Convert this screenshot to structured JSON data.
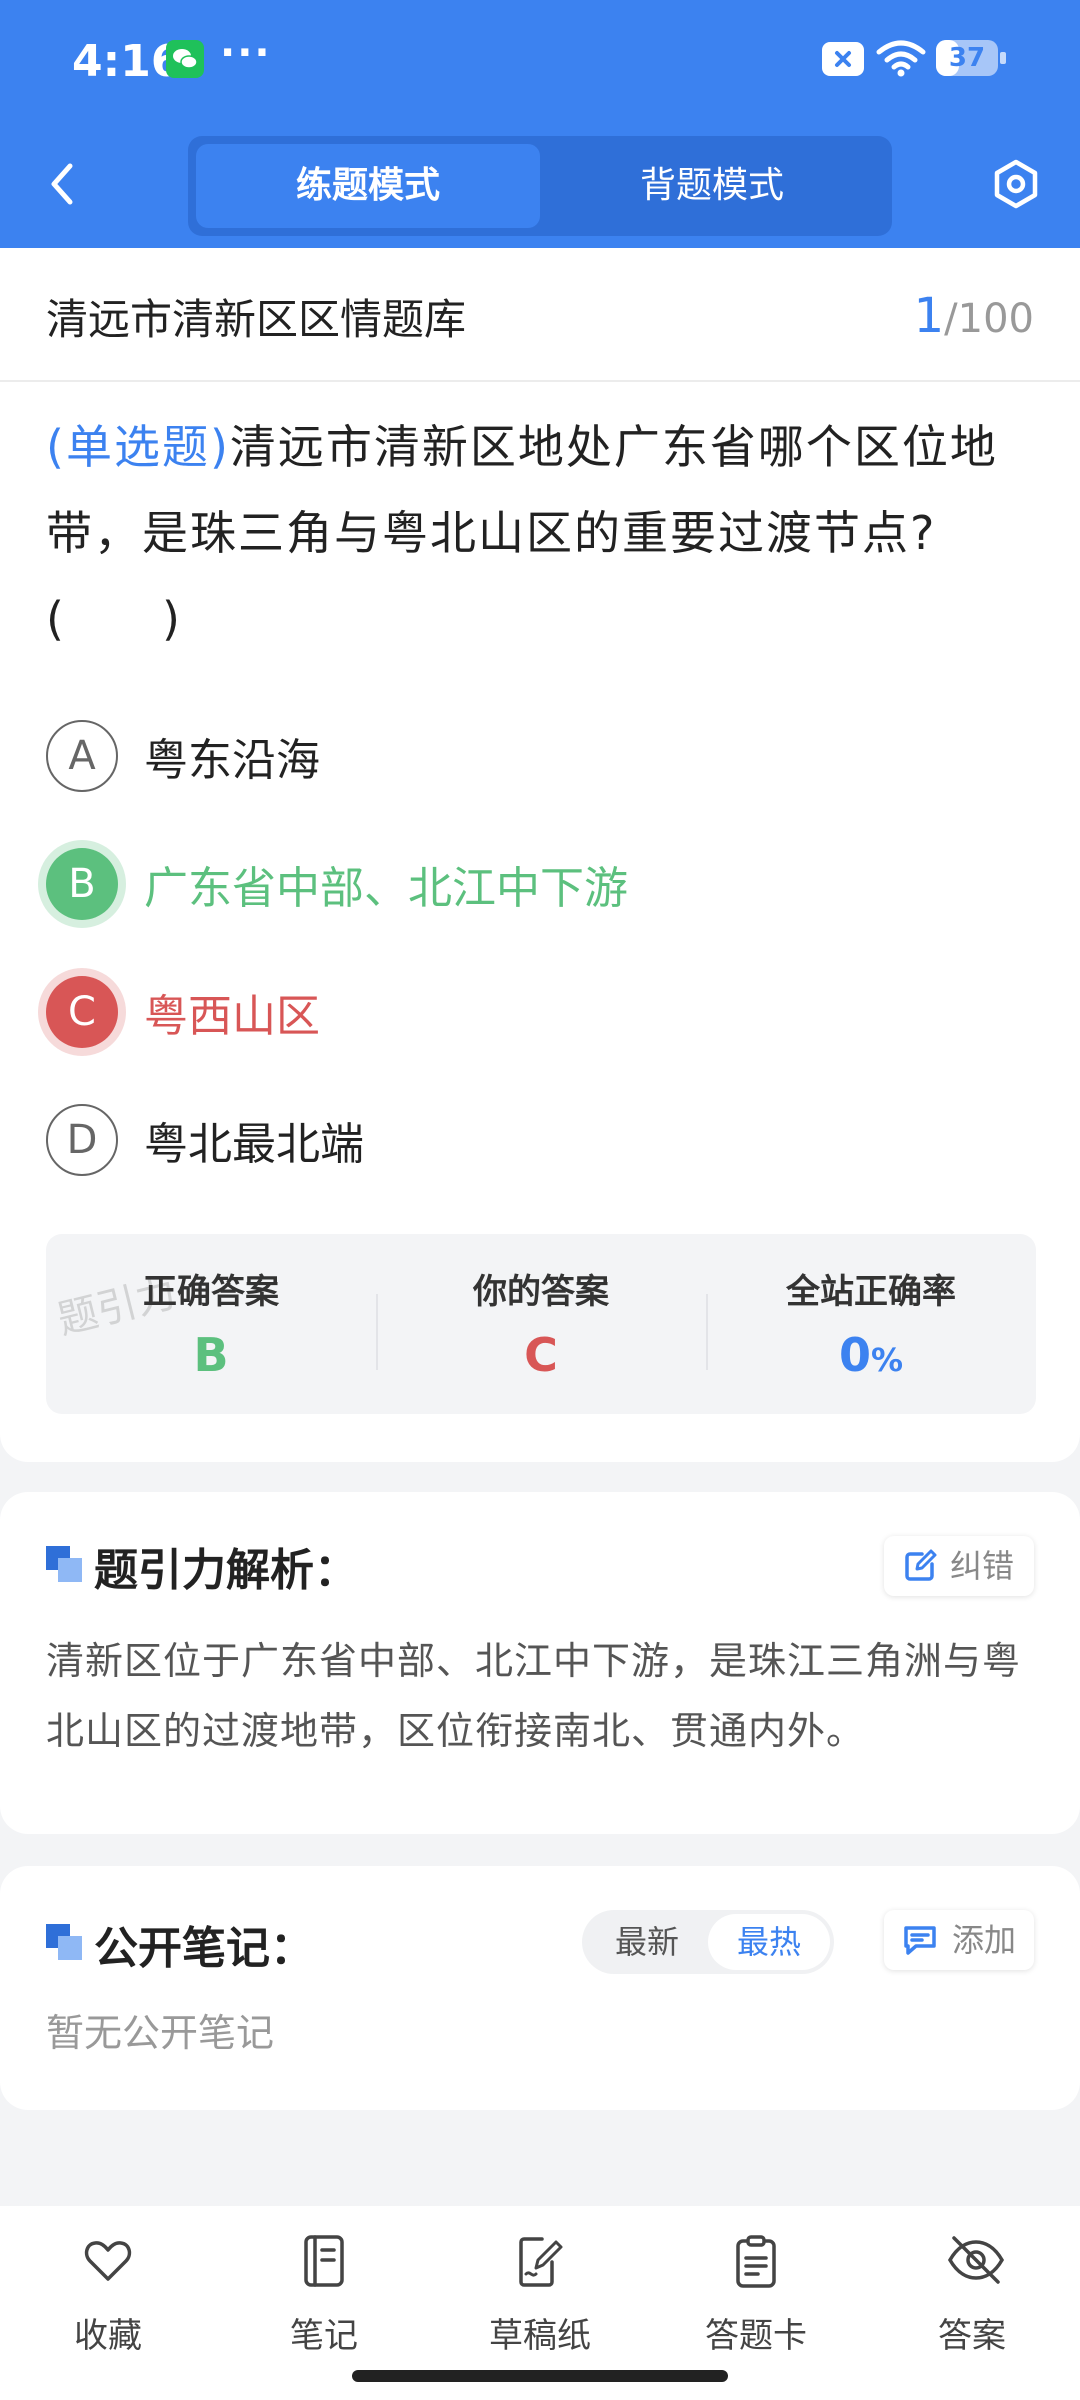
{
  "status_bar": {
    "time": "4:16",
    "dots": "···",
    "battery_level": "37"
  },
  "header": {
    "tabs": [
      {
        "label": "练题模式",
        "active": true
      },
      {
        "label": "背题模式",
        "active": false
      }
    ]
  },
  "question_bank": {
    "title": "清远市清新区区情题库",
    "current": "1",
    "total": "/100"
  },
  "question": {
    "type_label": "(单选题)",
    "text": "清远市清新区地处广东省哪个区位地带，是珠三角与粤北山区的重要过渡节点?(　　)"
  },
  "options": [
    {
      "letter": "A",
      "text": "粤东沿海",
      "state": "normal"
    },
    {
      "letter": "B",
      "text": "广东省中部、北江中下游",
      "state": "correct"
    },
    {
      "letter": "C",
      "text": "粤西山区",
      "state": "wrong"
    },
    {
      "letter": "D",
      "text": "粤北最北端",
      "state": "normal"
    }
  ],
  "stats": {
    "watermark": "题引力",
    "correct_label": "正确答案",
    "correct_value": "B",
    "yours_label": "你的答案",
    "yours_value": "C",
    "rate_label": "全站正确率",
    "rate_value": "0",
    "rate_unit": "%"
  },
  "analysis": {
    "title": "题引力解析：",
    "fix_label": "纠错",
    "text": "清新区位于广东省中部、北江中下游，是珠江三角洲与粤北山区的过渡地带，区位衔接南北、贯通内外。"
  },
  "notes": {
    "title": "公开笔记：",
    "sort_latest": "最新",
    "sort_hot": "最热",
    "add_label": "添加",
    "empty_text": "暂无公开笔记"
  },
  "bottom_nav": [
    {
      "label": "收藏",
      "icon": "heart-icon"
    },
    {
      "label": "笔记",
      "icon": "notebook-icon"
    },
    {
      "label": "草稿纸",
      "icon": "draft-paper-icon"
    },
    {
      "label": "答题卡",
      "icon": "answer-card-icon"
    },
    {
      "label": "答案",
      "icon": "eye-off-icon"
    }
  ],
  "colors": {
    "primary": "#3c82f0",
    "correct": "#5cc07e",
    "wrong": "#d85656"
  }
}
